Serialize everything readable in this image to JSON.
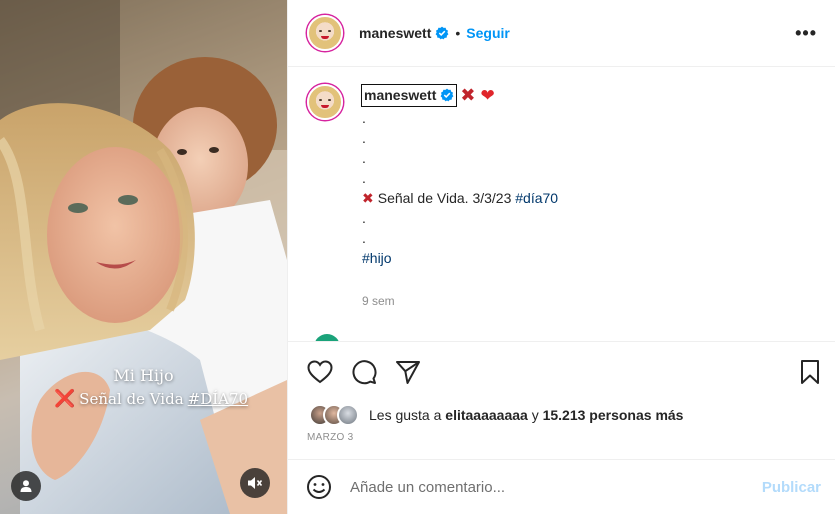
{
  "media": {
    "overlay_title": "Mi Hijo",
    "overlay_text": "Señal de Vida",
    "overlay_tag": "#DÍA70",
    "overlay_mark": "❌",
    "user_icon": "user-icon",
    "mute_icon": "speaker-muted-icon"
  },
  "header": {
    "username": "maneswett",
    "separator": "•",
    "follow_label": "Seguir",
    "more_label": "•••",
    "verified_color": "#0095f6"
  },
  "caption": {
    "username": "maneswett",
    "mark": "✖",
    "heart": "❤",
    "lines": [
      ".",
      ".",
      ".",
      "."
    ],
    "signal_mark": "✖",
    "signal_text": "Señal de Vida. 3/3/23 ",
    "signal_tag": "#día70",
    "lines2": [
      ".",
      "."
    ],
    "tag_hijo": "#hijo",
    "time": "9 sem"
  },
  "actions": {
    "like_icon": "heart-icon",
    "comment_icon": "comment-icon",
    "share_icon": "share-icon",
    "save_icon": "bookmark-icon"
  },
  "likes": {
    "prefix": "Les gusta a ",
    "user": "elitaaaaaaaa",
    "middle": " y ",
    "count": "15.213 personas más"
  },
  "date": "MARZO 3",
  "comment_box": {
    "placeholder": "Añade un comentario...",
    "publish_label": "Publicar",
    "emoji_icon": "emoji-icon"
  },
  "colors": {
    "accent": "#0095f6",
    "hashtag": "#00376b",
    "publish_disabled": "#b3dbfb",
    "mark_red": "#c0242c"
  }
}
